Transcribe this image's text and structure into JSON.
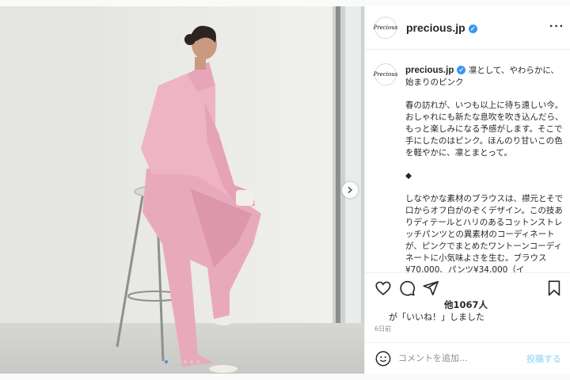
{
  "post": {
    "username": "precious.jp",
    "avatar_text": "Precious",
    "more_label": "···",
    "caption": {
      "username": "precious.jp",
      "title": "凛として、やわらかに、始まりのピンク",
      "paragraph1": "春の訪れが、いつも以上に待ち遠しい今。おしゃれにも新たな息吹を吹き込んだら、",
      "paragraph1b": "もっと楽しみになる予感がします。そこで手にしたのはピンク。ほんのり甘いこの色を軽やかに、凛とまとって。",
      "divider": "◆",
      "paragraph2": "しなやかな素材のブラウスは、襟元とそで口からオフ白がのぞくデザイン。この技ありディテールとハリのあるコットンストレッチパンツとの異素材のコーディネートが、ピンクでまとめたワントーンコーディネートに小気味よさを生む。ブラウス¥70,000、パンツ¥34,000（イ"
    },
    "likes_text": "他1067人",
    "liked_by_text": "が「いいね！」しました",
    "time_ago": "6日前",
    "comment_placeholder": "コメントを追加...",
    "post_button": "投稿する"
  },
  "carousel": {
    "active_index": 0,
    "count": 6
  },
  "icons": [
    "chevron-right-icon",
    "heart-icon",
    "comment-icon",
    "share-icon",
    "bookmark-icon",
    "emoji-icon",
    "verified-icon",
    "more-icon"
  ],
  "colors": {
    "accent": "#3897f0",
    "pink_outfit": "#e9a9bd",
    "post_button_disabled": "#b2dffc"
  }
}
